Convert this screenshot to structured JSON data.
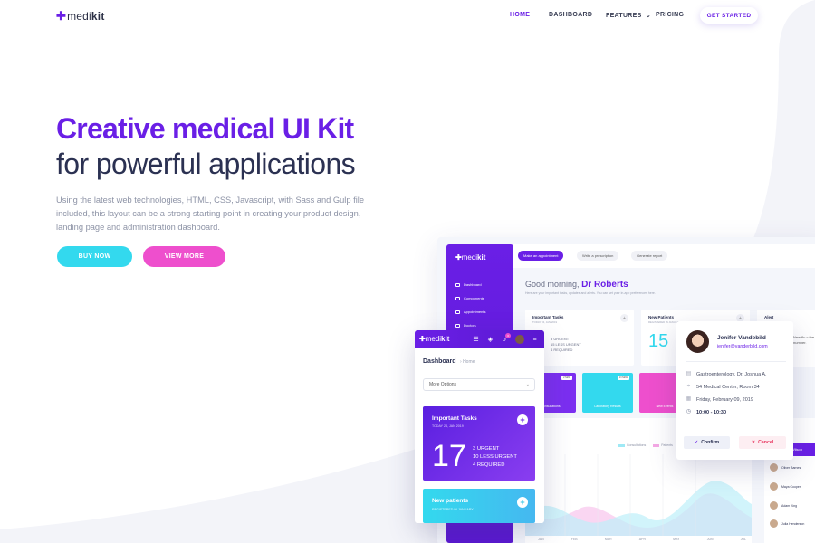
{
  "nav": {
    "logo_plus": "✚",
    "logo_part1": "medi",
    "logo_part2": "kit",
    "items": [
      {
        "label": "HOME"
      },
      {
        "label": "DASHBOARD"
      },
      {
        "label": "FEATURES"
      },
      {
        "label": "PRICING"
      }
    ],
    "features_chevron": "⌄",
    "cta": "GET STARTED"
  },
  "hero": {
    "title_line1": "Creative medical UI Kit",
    "title_line2": "for powerful applications",
    "description": "Using the latest web technologies, HTML, CSS, Javascript, with Sass and Gulp file included, this layout can be a strong starting point in creating your product design, landing page and administration dashboard.",
    "buy_label": "BUY NOW",
    "view_label": "VIEW MORE"
  },
  "dashboard": {
    "logo_plus": "✚",
    "logo_part1": "medi",
    "logo_part2": "kit",
    "sidebar": [
      {
        "label": "Dashboard"
      },
      {
        "label": "Components"
      },
      {
        "label": "Appointments"
      },
      {
        "label": "Doctors"
      }
    ],
    "topbar": [
      {
        "label": "Make an appointment"
      },
      {
        "label": "Write a prescription"
      },
      {
        "label": "Generate report"
      }
    ],
    "greeting": "Good morning,",
    "doctor": "Dr Roberts",
    "greeting_sub": "Here are your important tasks, updates and alerts. You can set your in-app preferences here.",
    "tasks_card": {
      "title": "Important Tasks",
      "sub": "TODAY 24, JAN 2019",
      "num": "3",
      "stats": [
        "3 URGENT",
        "15 LESS URGENT",
        "4 REQUIRED"
      ]
    },
    "patients_card": {
      "title": "New Patients",
      "sub": "REGISTERED IN JANUARY",
      "num": "15"
    },
    "alert_title": "Alert",
    "alert_text": "New flu c the states number.",
    "tiles": [
      {
        "label": "Consultations",
        "badge": "2 NEW",
        "color": "#7b2ff0"
      },
      {
        "label": "Laboratory Results",
        "badge": "13 NEW",
        "color": "#33d9ee"
      },
      {
        "label": "New Events",
        "badge": "",
        "color": "#ee4fcd"
      }
    ],
    "chart_legend": [
      "Consultations",
      "Patients"
    ],
    "months": [
      "JAN",
      "FEB",
      "MAR",
      "APR",
      "MAY",
      "JUN",
      "JUL"
    ],
    "list_header": "Wilson",
    "people": [
      "Oliver Barnes",
      "Maya Cooper",
      "Adam King",
      "Julia Henderson"
    ],
    "colors": {
      "accent": "#6a1fe6",
      "cyan": "#33d9ee",
      "pink": "#ee4fcd"
    }
  },
  "mobile": {
    "logo_plus": "✚",
    "logo_part1": "medi",
    "logo_part2": "kit",
    "notif_count": "3",
    "title": "Dashboard",
    "crumb": "Home",
    "select_label": "More Options",
    "task_title": "Important Tasks",
    "task_date": "TODAY 24, JAN 2019",
    "task_num": "17",
    "task_stats": [
      "3 URGENT",
      "10 LESS URGENT",
      "4 REQUIRED"
    ],
    "new_title": "New patients",
    "new_sub": "REGISTERED IN JANUARY"
  },
  "popup": {
    "name": "Jenifer Vandebild",
    "email": "jenifer@vanderbild.com",
    "rows": [
      {
        "icon": "clipboard-icon",
        "text": "Gastroenterology, Dr. Joshua A."
      },
      {
        "icon": "location-icon",
        "text": "54 Medical Center, Room 34"
      },
      {
        "icon": "calendar-icon",
        "text": "Friday, February 09, 2019"
      },
      {
        "icon": "clock-icon",
        "text": "10:00 - 10:30"
      }
    ],
    "confirm": "Confirm",
    "cancel": "Cancel"
  }
}
